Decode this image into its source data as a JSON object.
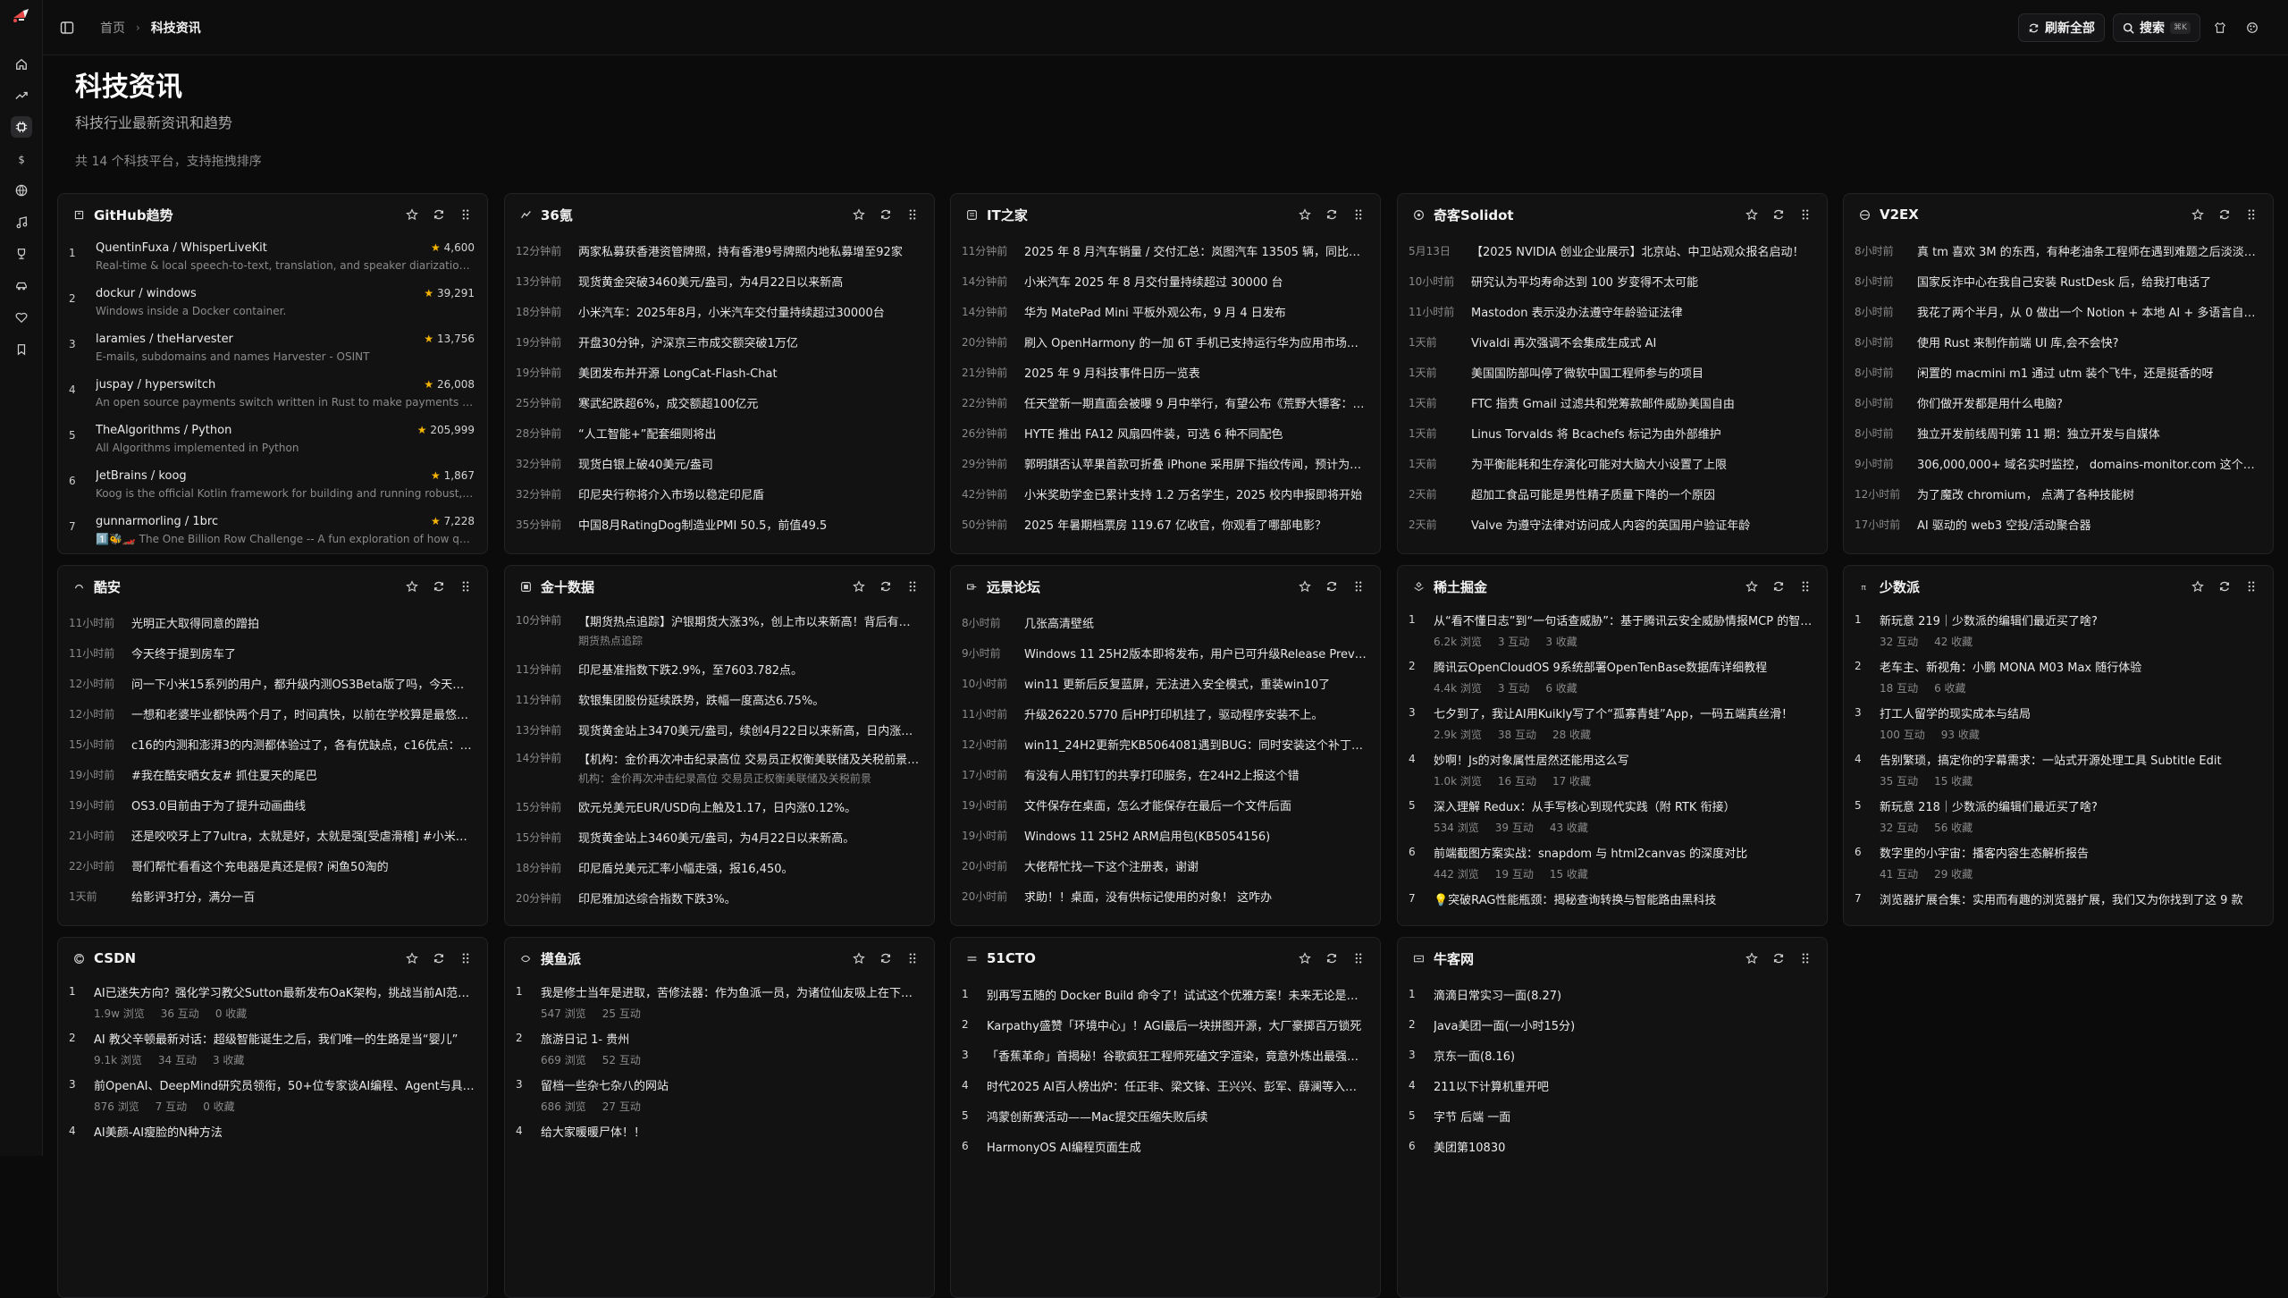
{
  "header": {
    "breadcrumb_home": "首页",
    "breadcrumb_current": "科技资讯",
    "refresh_all": "刷新全部",
    "search_label": "搜索",
    "search_shortcut": "⌘K"
  },
  "page": {
    "title": "科技资讯",
    "subtitle": "科技行业最新资讯和趋势",
    "count": "共 14 个科技平台，支持拖拽排序"
  },
  "cards": {
    "github": {
      "title": "GitHub趋势",
      "items": [
        {
          "rank": "1",
          "name": "QuentinFuxa / WhisperLiveKit",
          "stars": "4,600",
          "desc": "Real-time & local speech-to-text, translation, and speaker diarization…"
        },
        {
          "rank": "2",
          "name": "dockur / windows",
          "stars": "39,291",
          "desc": "Windows inside a Docker container."
        },
        {
          "rank": "3",
          "name": "laramies / theHarvester",
          "stars": "13,756",
          "desc": "E-mails, subdomains and names Harvester - OSINT"
        },
        {
          "rank": "4",
          "name": "juspay / hyperswitch",
          "stars": "26,008",
          "desc": "An open source payments switch written in Rust to make payments f…"
        },
        {
          "rank": "5",
          "name": "TheAlgorithms / Python",
          "stars": "205,999",
          "desc": "All Algorithms implemented in Python"
        },
        {
          "rank": "6",
          "name": "JetBrains / koog",
          "stars": "1,867",
          "desc": "Koog is the official Kotlin framework for building and running robust,…"
        },
        {
          "rank": "7",
          "name": "gunnarmorling / 1brc",
          "stars": "7,228",
          "desc": "1️⃣🐝🏎️ The One Billion Row Challenge -- A fun exploration of how q…"
        }
      ]
    },
    "kr36": {
      "title": "36氪",
      "items": [
        {
          "time": "12分钟前",
          "text": "两家私募获香港资管牌照，持有香港9号牌照内地私募增至92家"
        },
        {
          "time": "13分钟前",
          "text": "现货黄金突破3460美元/盎司，为4月22日以来新高"
        },
        {
          "time": "18分钟前",
          "text": "小米汽车：2025年8月，小米汽车交付量持续超过30000台"
        },
        {
          "time": "19分钟前",
          "text": "开盘30分钟，沪深京三市成交额突破1万亿"
        },
        {
          "time": "19分钟前",
          "text": "美团发布并开源 LongCat-Flash-Chat"
        },
        {
          "time": "25分钟前",
          "text": "寒武纪跌超6%，成交额超100亿元"
        },
        {
          "time": "28分钟前",
          "text": "“人工智能+”配套细则将出"
        },
        {
          "time": "32分钟前",
          "text": "现货白银上破40美元/盎司"
        },
        {
          "time": "32分钟前",
          "text": "印尼央行称将介入市场以稳定印尼盾"
        },
        {
          "time": "35分钟前",
          "text": "中国8月RatingDog制造业PMI 50.5，前值49.5"
        }
      ]
    },
    "ithome": {
      "title": "IT之家",
      "items": [
        {
          "time": "11分钟前",
          "text": "2025 年 8 月汽车销量 / 交付汇总：岚图汽车 13505 辆，同比增…"
        },
        {
          "time": "14分钟前",
          "text": "小米汽车 2025 年 8 月交付量持续超过 30000 台"
        },
        {
          "time": "14分钟前",
          "text": "华为 MatePad Mini 平板外观公布，9 月 4 日发布"
        },
        {
          "time": "20分钟前",
          "text": "刷入 OpenHarmony 的一加 6T 手机已支持运行华为应用市场，…"
        },
        {
          "time": "21分钟前",
          "text": "2025 年 9 月科技事件日历一览表"
        },
        {
          "time": "22分钟前",
          "text": "任天堂新一期直面会被曝 9 月中举行，有望公布《荒野大镖客：…"
        },
        {
          "time": "26分钟前",
          "text": "HYTE 推出 FA12 风扇四件装，可选 6 种不同配色"
        },
        {
          "time": "29分钟前",
          "text": "郭明錤否认苹果首款可折叠 iPhone 采用屏下指纹传闻，预计为…"
        },
        {
          "time": "42分钟前",
          "text": "小米奖助学金已累计支持 1.2 万名学生，2025 校内申报即将开始"
        },
        {
          "time": "50分钟前",
          "text": "2025 年暑期档票房 119.67 亿收官，你观看了哪部电影？"
        }
      ]
    },
    "solidot": {
      "title": "奇客Solidot",
      "items": [
        {
          "time": "5月13日",
          "text": "【2025 NVIDIA 创业企业展示】北京站、中卫站观众报名启动！"
        },
        {
          "time": "10小时前",
          "text": "研究认为平均寿命达到 100 岁变得不太可能"
        },
        {
          "time": "11小时前",
          "text": "Mastodon 表示没办法遵守年龄验证法律"
        },
        {
          "time": "1天前",
          "text": "Vivaldi 再次强调不会集成生成式 AI"
        },
        {
          "time": "1天前",
          "text": "美国国防部叫停了微软中国工程师参与的项目"
        },
        {
          "time": "1天前",
          "text": "FTC 指责 Gmail 过滤共和党筹款邮件威胁美国自由"
        },
        {
          "time": "1天前",
          "text": "Linus Torvalds 将 Bcachefs 标记为由外部维护"
        },
        {
          "time": "1天前",
          "text": "为平衡能耗和生存演化可能对大脑大小设置了上限"
        },
        {
          "time": "2天前",
          "text": "超加工食品可能是男性精子质量下降的一个原因"
        },
        {
          "time": "2天前",
          "text": "Valve 为遵守法律对访问成人内容的英国用户验证年龄"
        }
      ]
    },
    "v2ex": {
      "title": "V2EX",
      "items": [
        {
          "time": "8小时前",
          "text": "真 tm 喜欢 3M 的东西，有种老油条工程师在遇到难题之后淡淡…"
        },
        {
          "time": "8小时前",
          "text": "国家反诈中心在我自己安装 RustDesk 后，给我打电话了"
        },
        {
          "time": "8小时前",
          "text": "我花了两个半月，从 0 做出一个 Notion + 本地 AI + 多语言自动…"
        },
        {
          "time": "8小时前",
          "text": "使用 Rust 来制作前端 UI 库,会不会快?"
        },
        {
          "time": "8小时前",
          "text": "闲置的 macmini m1 通过 utm 装个飞牛，还是挺香的呀"
        },
        {
          "time": "8小时前",
          "text": "你们做开发都是用什么电脑?"
        },
        {
          "time": "8小时前",
          "text": "独立开发前线周刊第 11 期：独立开发与自媒体"
        },
        {
          "time": "9小时前",
          "text": "306,000,000+ 域名实时监控， domains-monitor.com 这个域…"
        },
        {
          "time": "12小时前",
          "text": "为了魔改 chromium， 点满了各种技能树"
        },
        {
          "time": "17小时前",
          "text": "AI 驱动的 web3 空投/活动聚合器"
        }
      ]
    },
    "coolapk": {
      "title": "酷安",
      "items": [
        {
          "time": "11小时前",
          "text": "光明正大取得同意的蹭拍"
        },
        {
          "time": "11小时前",
          "text": "今天终于提到房车了"
        },
        {
          "time": "12小时前",
          "text": "问一下小米15系列的用户，都升级内测OS3Beta版了吗，今天想试…"
        },
        {
          "time": "12小时前",
          "text": "一想和老婆毕业都快两个月了，时间真快，以前在学校算是最悠…"
        },
        {
          "time": "15小时前",
          "text": "c16的内测和澎湃3的内测都体验过了，各有优缺点，c16优点：…"
        },
        {
          "time": "19小时前",
          "text": "#我在酷安晒女友# 抓住夏天的尾巴"
        },
        {
          "time": "19小时前",
          "text": "OS3.0目前由于为了提升动画曲线"
        },
        {
          "time": "21小时前",
          "text": "还是咬咬牙上了7ultra，太就是好，太就是强[受虐滑稽] #小米平…"
        },
        {
          "time": "22小时前",
          "text": "哥们帮忙看看这个充电器是真还是假? 闲鱼50淘的"
        },
        {
          "time": "1天前",
          "text": "给影评3打分，满分一百"
        }
      ]
    },
    "jin10": {
      "title": "金十数据",
      "items": [
        {
          "time": "10分钟前",
          "text": "【期货热点追踪】沪银期货大涨3%，创上市以来新高！背后有哪…",
          "extra": "期货热点追踪"
        },
        {
          "time": "11分钟前",
          "text": "印尼基准指数下跌2.9%，至7603.782点。",
          "extra": ""
        },
        {
          "time": "11分钟前",
          "text": "软银集团股份延续跌势，跌幅一度高达6.75%。",
          "extra": ""
        },
        {
          "time": "13分钟前",
          "text": "现货黄金站上3470美元/盎司，续创4月22日以来新高，日内涨幅…",
          "extra": ""
        },
        {
          "time": "14分钟前",
          "text": "【机构：金价再次冲击纪录高位 交易员正权衡美联储及关税前景…",
          "extra": "机构：金价再次冲击纪录高位 交易员正权衡美联储及关税前景"
        },
        {
          "time": "15分钟前",
          "text": "欧元兑美元EUR/USD向上触及1.17，日内涨0.12%。",
          "extra": ""
        },
        {
          "time": "15分钟前",
          "text": "现货黄金站上3460美元/盎司，为4月22日以来新高。",
          "extra": ""
        },
        {
          "time": "18分钟前",
          "text": "印尼盾兑美元汇率小幅走强，报16,450。",
          "extra": ""
        },
        {
          "time": "20分钟前",
          "text": "印尼雅加达综合指数下跌3%。",
          "extra": ""
        }
      ]
    },
    "pcbeta": {
      "title": "远景论坛",
      "items": [
        {
          "time": "8小时前",
          "text": "几张高清壁纸"
        },
        {
          "time": "9小时前",
          "text": "Windows 11 25H2版本即将发布，用户已可升级Release Previe…"
        },
        {
          "time": "10小时前",
          "text": "win11 更新后反复蓝屏，无法进入安全模式，重装win10了"
        },
        {
          "time": "11小时前",
          "text": "升级26220.5770 后HP打印机挂了，驱动程序安装不上。"
        },
        {
          "time": "12小时前",
          "text": "win11_24H2更新完KB5064081遇到BUG：同时安装这个补丁的…"
        },
        {
          "time": "17小时前",
          "text": "有没有人用钉钉的共享打印服务，在24H2上报这个错"
        },
        {
          "time": "19小时前",
          "text": "文件保存在桌面，怎么才能保存在最后一个文件后面"
        },
        {
          "time": "19小时前",
          "text": "Windows 11 25H2 ARM启用包(KB5054156)"
        },
        {
          "time": "20小时前",
          "text": "大佬帮忙找一下这个注册表，谢谢"
        },
        {
          "time": "20小时前",
          "text": "求助！！桌面，没有供标记使用的对象！ 这咋办"
        }
      ]
    },
    "juejin": {
      "title": "稀土掘金",
      "items": [
        {
          "rank": "1",
          "text": "从“看不懂日志”到“一句话查威胁”：基于腾讯云安全威胁情报MCP 的智…",
          "views": "6.2k 浏览",
          "likes": "3 互动",
          "saves": "3 收藏"
        },
        {
          "rank": "2",
          "text": "腾讯云OpenCloudOS 9系统部署OpenTenBase数据库详细教程",
          "views": "4.4k 浏览",
          "likes": "3 互动",
          "saves": "6 收藏"
        },
        {
          "rank": "3",
          "text": "七夕到了，我让AI用Kuikly写了个“孤寡青蛙”App，一码五端真丝滑！",
          "views": "2.9k 浏览",
          "likes": "38 互动",
          "saves": "28 收藏"
        },
        {
          "rank": "4",
          "text": "妙啊！Js的对象属性居然还能用这么写",
          "views": "1.0k 浏览",
          "likes": "16 互动",
          "saves": "17 收藏"
        },
        {
          "rank": "5",
          "text": "深入理解 Redux：从手写核心到现代实践（附 RTK 衔接）",
          "views": "534 浏览",
          "likes": "39 互动",
          "saves": "43 收藏"
        },
        {
          "rank": "6",
          "text": "前端截图方案实战：snapdom 与 html2canvas 的深度对比",
          "views": "442 浏览",
          "likes": "19 互动",
          "saves": "15 收藏"
        },
        {
          "rank": "7",
          "text": "💡突破RAG性能瓶颈：揭秘查询转换与智能路由黑科技",
          "views": "",
          "likes": "",
          "saves": ""
        }
      ]
    },
    "sspai": {
      "title": "少数派",
      "items": [
        {
          "rank": "1",
          "text": "新玩意 219｜少数派的编辑们最近买了啥?",
          "views": "32 互动",
          "saves": "42 收藏"
        },
        {
          "rank": "2",
          "text": "老车主、新视角：小鹏 MONA M03 Max 随行体验",
          "views": "18 互动",
          "saves": "6 收藏"
        },
        {
          "rank": "3",
          "text": "打工人留学的现实成本与结局",
          "views": "100 互动",
          "saves": "93 收藏"
        },
        {
          "rank": "4",
          "text": "告别繁琐，搞定你的字幕需求：一站式开源处理工具 Subtitle Edit",
          "views": "35 互动",
          "saves": "15 收藏"
        },
        {
          "rank": "5",
          "text": "新玩意 218｜少数派的编辑们最近买了啥?",
          "views": "32 互动",
          "saves": "56 收藏"
        },
        {
          "rank": "6",
          "text": "数字里的小宇宙：播客内容生态解析报告",
          "views": "41 互动",
          "saves": "29 收藏"
        },
        {
          "rank": "7",
          "text": "浏览器扩展合集：实用而有趣的浏览器扩展，我们又为你找到了这 9 款",
          "views": "",
          "saves": ""
        }
      ]
    },
    "csdn": {
      "title": "CSDN",
      "items": [
        {
          "rank": "1",
          "text": "AI已迷失方向？强化学习教父Sutton最新发布OaK架构，挑战当前AI范式…",
          "views": "1.9w 浏览",
          "likes": "36 互动",
          "saves": "0 收藏"
        },
        {
          "rank": "2",
          "text": "AI 教父辛顿最新对话：超级智能诞生之后，我们唯一的生路是当“婴儿”",
          "views": "9.1k 浏览",
          "likes": "34 互动",
          "saves": "3 收藏"
        },
        {
          "rank": "3",
          "text": "前OpenAI、DeepMind研究员领衔，50+位专家谈AI编程、Agent与具身…",
          "views": "876 浏览",
          "likes": "7 互动",
          "saves": "0 收藏"
        },
        {
          "rank": "4",
          "text": "AI美颜-AI瘦脸的N种方法",
          "views": "",
          "likes": "",
          "saves": ""
        }
      ]
    },
    "mofish": {
      "title": "摸鱼派",
      "items": [
        {
          "rank": "1",
          "text": "我是修士当年是进取，苦修法器：作为鱼派一员，为诸位仙友吸上在下的…",
          "views": "547 浏览",
          "likes": "25 互动"
        },
        {
          "rank": "2",
          "text": "旅游日记 1- 贵州",
          "views": "669 浏览",
          "likes": "52 互动"
        },
        {
          "rank": "3",
          "text": "留档一些杂七杂八的网站",
          "views": "686 浏览",
          "likes": "27 互动"
        },
        {
          "rank": "4",
          "text": "给大家暖暖尸体！！",
          "views": "",
          "likes": ""
        }
      ]
    },
    "cto51": {
      "title": "51CTO",
      "items": [
        {
          "rank": "1",
          "text": "别再写五随的 Docker Build 命令了！试试这个优雅方案！未来无论是单…"
        },
        {
          "rank": "2",
          "text": "Karpathy盛赞「环境中心」！AGI最后一块拼图开源，大厂豪掷百万锁死"
        },
        {
          "rank": "3",
          "text": "「香蕉革命」首揭秘！谷歌疯狂工程师死磕文字渲染，竟意外炼出最强模型"
        },
        {
          "rank": "4",
          "text": "时代2025 AI百人榜出炉：任正非、梁文锋、王兴兴、彭军、薛澜等入选…"
        },
        {
          "rank": "5",
          "text": "鸿蒙创新赛活动——Mac提交压缩失败后续"
        },
        {
          "rank": "6",
          "text": "HarmonyOS AI编程页面生成"
        }
      ]
    },
    "nowcoder": {
      "title": "牛客网",
      "items": [
        {
          "rank": "1",
          "text": "滴滴日常实习一面(8.27)"
        },
        {
          "rank": "2",
          "text": "Java美团一面(一小时15分)"
        },
        {
          "rank": "3",
          "text": "京东一面(8.16)"
        },
        {
          "rank": "4",
          "text": "211以下计算机重开吧"
        },
        {
          "rank": "5",
          "text": "字节 后端 一面"
        },
        {
          "rank": "6",
          "text": "美团第10830"
        }
      ]
    }
  }
}
